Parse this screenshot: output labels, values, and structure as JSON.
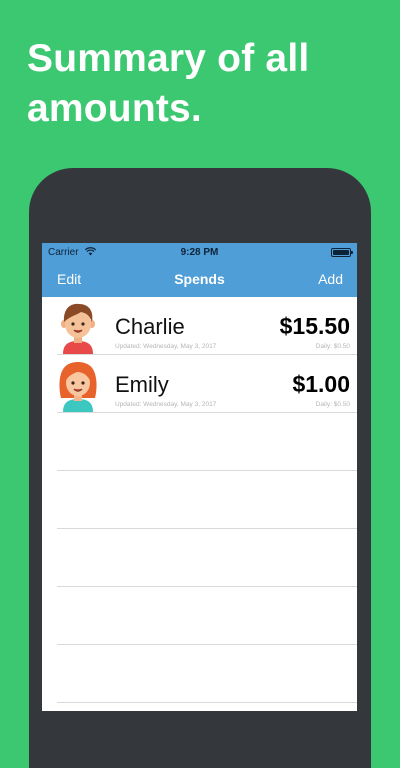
{
  "headline": {
    "line1": "Summary of all",
    "line2": "amounts."
  },
  "status_bar": {
    "carrier": "Carrier",
    "time": "9:28 PM"
  },
  "nav": {
    "edit_label": "Edit",
    "title": "Spends",
    "add_label": "Add"
  },
  "people": [
    {
      "name": "Charlie",
      "amount": "$15.50",
      "updated": "Updated: Wednesday, May 3, 2017",
      "daily": "Daily: $0.50",
      "avatar": "boy-avatar"
    },
    {
      "name": "Emily",
      "amount": "$1.00",
      "updated": "Updated: Wednesday, May 3, 2017",
      "daily": "Daily: $0.50",
      "avatar": "girl-avatar"
    }
  ],
  "colors": {
    "background": "#3cc870",
    "nav_bar": "#4f9ed7",
    "phone_frame": "#34383c"
  }
}
